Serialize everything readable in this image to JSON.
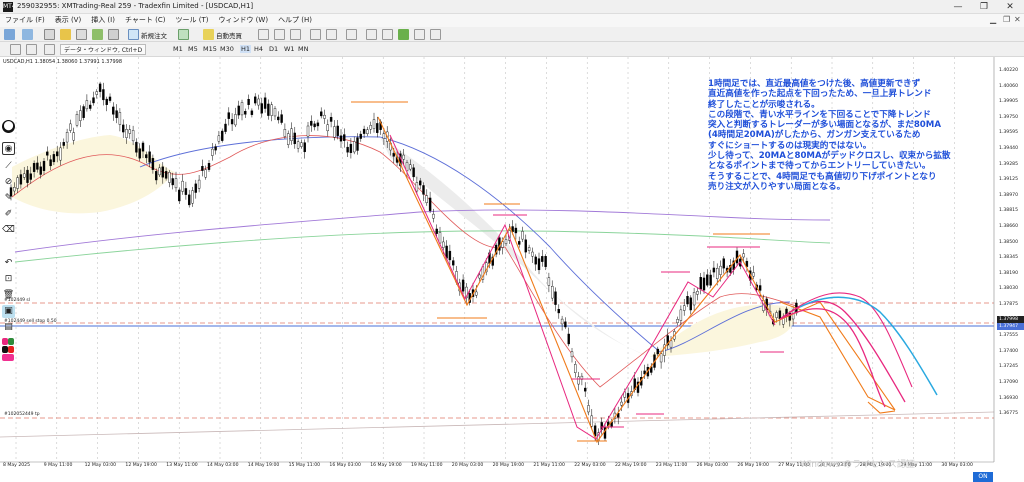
{
  "window": {
    "title": "259032955: XMTrading-Real 259 - Tradexfin Limited - [USDCAD,H1]",
    "app_icon": "MT4",
    "minimize": "—",
    "restore": "❐",
    "close": "✕"
  },
  "menu": [
    "ファイル (F)",
    "表示 (V)",
    "挿入 (I)",
    "チャート (C)",
    "ツール (T)",
    "ウィンドウ (W)",
    "ヘルプ (H)"
  ],
  "toolbar": {
    "new_order": "新規注文",
    "auto_trade": "自動売買",
    "timeframes": [
      "M1",
      "M5",
      "M15",
      "M30",
      "H1",
      "H4",
      "D1",
      "W1",
      "MN"
    ],
    "data_window_label": "データ・ウィンドウ, Ctrl+D"
  },
  "chart": {
    "symbol_info": "USDCAD,H1  1.38054 1.38060 1.37991 1.37998",
    "price_labels": [
      "1.40220",
      "1.40060",
      "1.39905",
      "1.39750",
      "1.39595",
      "1.39440",
      "1.39285",
      "1.39125",
      "1.38970",
      "1.38815",
      "1.38660",
      "1.38500",
      "1.38345",
      "1.38190",
      "1.38030",
      "1.37875",
      "1.37710",
      "1.37555",
      "1.37400",
      "1.37245",
      "1.37090",
      "1.36930",
      "1.36775"
    ],
    "current_price": "1.37998",
    "line_price": "1.37947",
    "time_labels": [
      "8 May 2025",
      "9 May 11:00",
      "12 May 03:00",
      "12 May 19:00",
      "13 May 11:00",
      "14 May 03:00",
      "14 May 19:00",
      "15 May 11:00",
      "16 May 03:00",
      "16 May 19:00",
      "19 May 11:00",
      "20 May 03:00",
      "20 May 19:00",
      "21 May 11:00",
      "22 May 03:00",
      "22 May 19:00",
      "23 May 11:00",
      "26 May 03:00",
      "26 May 19:00",
      "27 May 11:00",
      "28 May 03:00",
      "28 May 19:00",
      "29 May 11:00",
      "30 May 03:00"
    ],
    "order_labels": [
      "#102449 sl",
      "#102449 sell stop 0.50",
      "#102052449 tp"
    ],
    "annotation": [
      "1時間足では、直近最高値をつけた後、高値更新できず",
      "直近高値を作った起点を下回ったため、一旦上昇トレンド",
      "終了したことが示唆される。",
      "この段階で、青い水平ラインを下回ることで下降トレンド",
      "突入と判断するトレーダーが多い場面となるが、まだ80MA",
      "(4時間足20MA)がしたから、ガンガン支えているため",
      "すぐにショートするのは現実的ではない。",
      "少し待って、20MAと80MAがデッドクロスし、収束から拡散",
      "となるポイントまで待ってからエントリーしていきたい。",
      "そうすることで、4時間足でも高値切り下げポイントとなり",
      "売り注文が入りやすい局面となる。"
    ],
    "watermark": "Windows のライセンス認証",
    "on_button": "ON"
  },
  "colors": {
    "bg": "#ffffff",
    "annotation": "#1f4fd9",
    "bull_candle": "#ffffff",
    "bear_candle": "#000000",
    "orange": "#f07b1a",
    "magenta": "#e8287f",
    "blue_ma": "#5d6fd8",
    "purple_ma": "#a27ad8",
    "green_ma": "#8bd49b",
    "red_ma": "#e05a5a",
    "cyan": "#2aa9e0"
  }
}
